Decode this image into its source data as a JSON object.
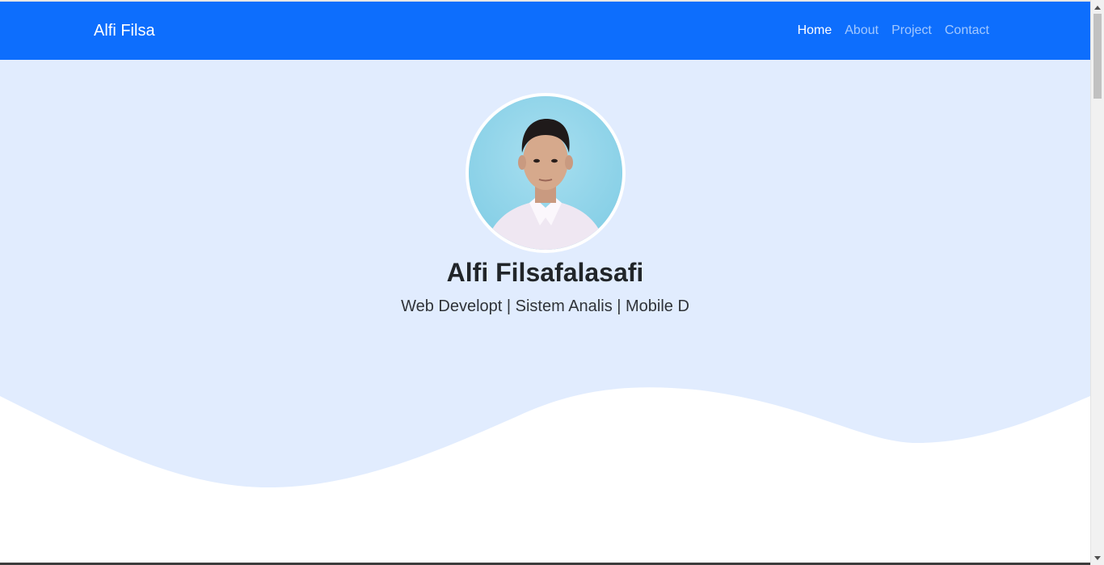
{
  "navbar": {
    "brand": "Alfi Filsa",
    "links": [
      {
        "label": "Home",
        "active": true
      },
      {
        "label": "About",
        "active": false
      },
      {
        "label": "Project",
        "active": false
      },
      {
        "label": "Contact",
        "active": false
      }
    ]
  },
  "hero": {
    "name": "Alfi Filsafalasafi",
    "tagline": "Web Developt | Sistem Analis | Mobile D"
  },
  "colors": {
    "navbar": "#0d6efd",
    "hero_background": "#e1ecfe",
    "page_background": "#ffffff"
  }
}
